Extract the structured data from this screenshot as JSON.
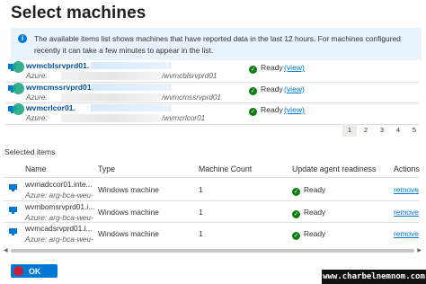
{
  "header": {
    "title": "Select machines",
    "more": "···"
  },
  "info": {
    "text": "The available items list shows machines that have reported data in the last 12 hours. For machines configured recently it can take a few minutes to appear in the list."
  },
  "machines": [
    {
      "name": "wvmcblsrvprd01.",
      "azure": "Azure:",
      "path": "/wvmcblsrvprd01",
      "status": "Ready",
      "view": "(view)"
    },
    {
      "name": "wvmcmssrvprd01.",
      "azure": "Azure:",
      "path": "/wvmcmssrvprd01",
      "status": "Ready",
      "view": "(view)"
    },
    {
      "name": "wvmcrlcor01.",
      "azure": "Azure:",
      "path": "/wvmcrlcor01",
      "status": "Ready",
      "view": "(view)"
    }
  ],
  "pager": [
    "1",
    "2",
    "3",
    "4",
    "5"
  ],
  "selected": {
    "label": "Selected items",
    "columns": {
      "name": "Name",
      "type": "Type",
      "count": "Machine Count",
      "readiness": "Update agent readiness",
      "actions": "Actions"
    },
    "rows": [
      {
        "name": "wvmadccor01.inte...",
        "azure": "Azure: arg-bca-weu-",
        "type": "Windows machine",
        "count": "1",
        "status": "Ready",
        "action": "remove"
      },
      {
        "name": "wvmbomsrvprd01.i...",
        "azure": "Azure: arg-bca-weu-",
        "type": "Windows machine",
        "count": "1",
        "status": "Ready",
        "action": "remove"
      },
      {
        "name": "wvmcadsrvprd01.i...",
        "azure": "Azure: arg-bca-weu-",
        "type": "Windows machine",
        "count": "1",
        "status": "Ready",
        "action": "remove"
      }
    ]
  },
  "footer": {
    "ok_label": "OK",
    "watermark": "www.charbelnemnom.com"
  },
  "colors": {
    "accent": "#0078d4",
    "success": "#107c10",
    "info_bg": "#e8f3fc"
  }
}
